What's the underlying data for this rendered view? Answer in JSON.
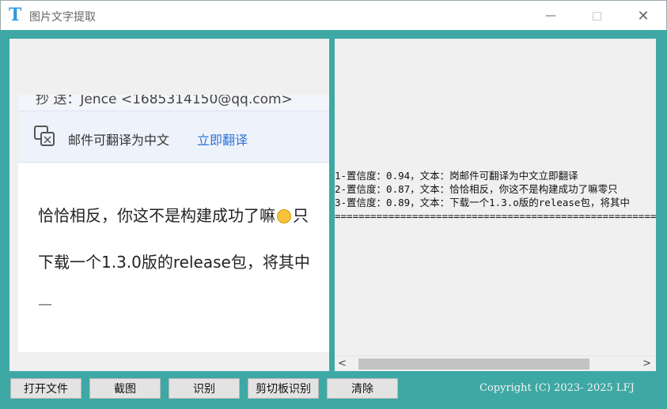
{
  "window": {
    "title": "图片文字提取",
    "logo_letter": "T",
    "controls": [
      "minimize",
      "maximize",
      "close"
    ],
    "min_glyph": "—",
    "close_glyph": "✕"
  },
  "left_image": {
    "cut_text": "抄 送：Jence <1685314150@qq.com>",
    "banner_text": "邮件可翻译为中文",
    "banner_link": "立即翻译",
    "line1": "恰恰相反，你这不是构建成功了嘛",
    "line1_tail": "只",
    "line2": "下载一个1.3.0版的release包，将其中",
    "dash": "—"
  },
  "result_lines": [
    "1-置信度：0.94，文本：岗邮件可翻译为中文立即翻译",
    "2-置信度：0.87，文本：恰恰相反，你这不是构建成功了嘛零只",
    "3-置信度：0.89，文本：下载一个1.3.o版的release包，将其中",
    "=========================================================================="
  ],
  "scrollbar": {
    "left_arrow": "<",
    "right_arrow": ">"
  },
  "buttons": {
    "open_file": "打开文件",
    "screenshot": "截图",
    "recognize": "识别",
    "clipboard": "剪切板识别",
    "clear": "清除"
  },
  "copyright": "Copyright (C) 2023- 2025 LFJ",
  "colors": {
    "background": "#3ea8a4",
    "logo": "#2f9ae0",
    "link": "#2c72d8"
  }
}
